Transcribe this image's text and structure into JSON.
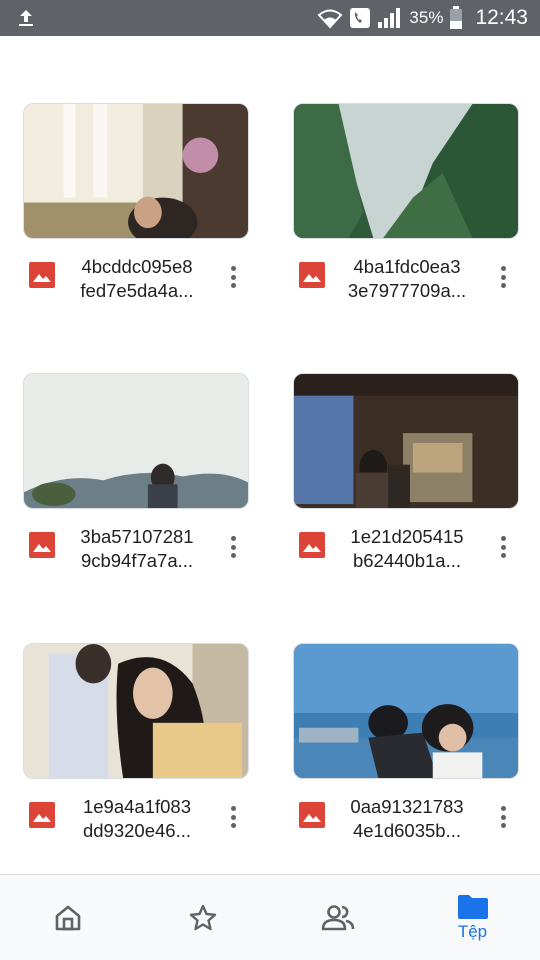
{
  "status_bar": {
    "battery": "35%",
    "time": "12:43",
    "icons": [
      "upload-icon",
      "wifi-icon",
      "phone-call-icon",
      "signal-icon",
      "battery-icon"
    ]
  },
  "files": [
    {
      "name_line1": "4bcddc095e8",
      "name_line2": "fed7e5da4a...",
      "type_icon": "image-file-icon"
    },
    {
      "name_line1": "4ba1fdc0ea3",
      "name_line2": "3e7977709a...",
      "type_icon": "image-file-icon"
    },
    {
      "name_line1": "3ba57107281",
      "name_line2": "9cb94f7a7a...",
      "type_icon": "image-file-icon"
    },
    {
      "name_line1": "1e21d205415",
      "name_line2": "b62440b1a...",
      "type_icon": "image-file-icon"
    },
    {
      "name_line1": "1e9a4a1f083",
      "name_line2": "dd9320e46...",
      "type_icon": "image-file-icon"
    },
    {
      "name_line1": "0aa91321783",
      "name_line2": "4e1d6035b...",
      "type_icon": "image-file-icon"
    }
  ],
  "bottom_nav": {
    "items": [
      {
        "icon": "home-icon",
        "label": ""
      },
      {
        "icon": "star-icon",
        "label": ""
      },
      {
        "icon": "people-icon",
        "label": ""
      },
      {
        "icon": "folder-icon",
        "label": "Tệp"
      }
    ],
    "active_color": "#1a73e8",
    "inactive_color": "#5f6368"
  },
  "colors": {
    "status_bar": "#5f6368",
    "image_icon": "#db4437",
    "text": "#202124"
  }
}
